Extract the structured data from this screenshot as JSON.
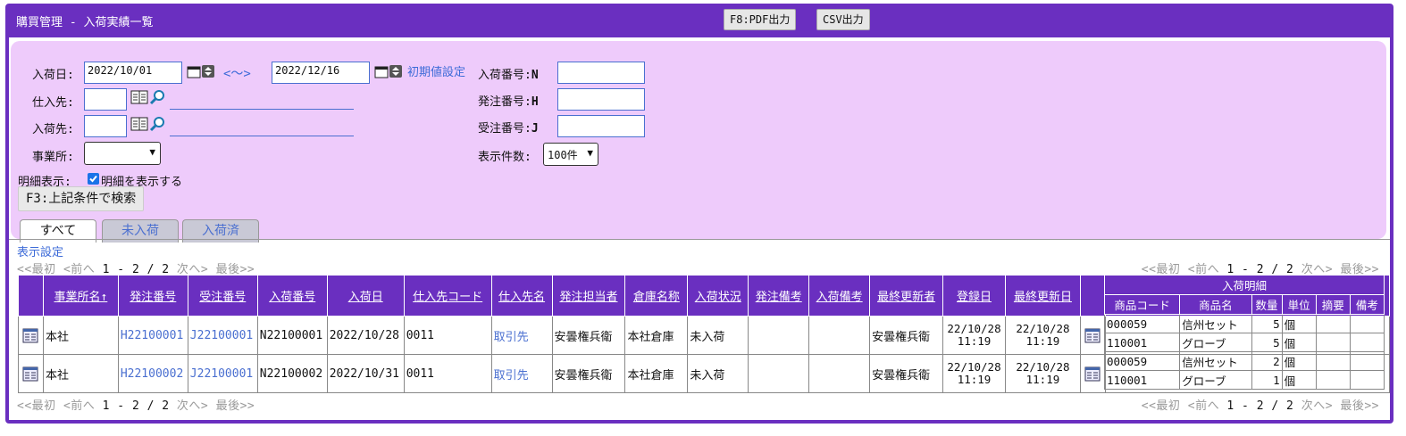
{
  "window": {
    "title": "購買管理 - 入荷実績一覧"
  },
  "toolbar": {
    "pdf_label": "F8:PDF出力",
    "csv_label": "CSV出力"
  },
  "search": {
    "arrival_date_label": "入荷日:",
    "date_from": "2022/10/01",
    "range_sep": "<～>",
    "date_to": "2022/12/16",
    "reset_link": "初期値設定",
    "supplier_label": "仕入先:",
    "receiver_label": "入荷先:",
    "office_label": "事業所:",
    "detail_label": "明細表示:",
    "detail_checkbox_label": "明細を表示する",
    "arrival_no_label": "入荷番号:",
    "arrival_no_key": "N",
    "order_no_label": "発注番号:",
    "order_no_key": "H",
    "receive_no_label": "受注番号:",
    "receive_no_key": "J",
    "count_label": "表示件数:",
    "count_value": "100件",
    "search_button": "F3:上記条件で検索"
  },
  "tabs": [
    {
      "label": "すべて",
      "active": true
    },
    {
      "label": "未入荷",
      "active": false
    },
    {
      "label": "入荷済",
      "active": false
    }
  ],
  "display_settings": "表示設定",
  "pager": {
    "first": "<<最初",
    "prev": "<前へ",
    "range": "1 - 2 / 2",
    "next": "次へ>",
    "last": "最後>>"
  },
  "table": {
    "headers": [
      "事業所名↑",
      "発注番号",
      "受注番号",
      "入荷番号",
      "入荷日",
      "仕入先コード",
      "仕入先名",
      "発注担当者",
      "倉庫名称",
      "入荷状況",
      "発注備考",
      "入荷備考",
      "最終更新者",
      "登録日",
      "最終更新日"
    ],
    "detail_group": "入荷明細",
    "detail_headers": [
      "商品コード",
      "商品名",
      "数量",
      "単位",
      "摘要",
      "備考"
    ],
    "rows": [
      {
        "office": "本社",
        "order_no": "H22100001",
        "receive_no": "J22100001",
        "arrival_no": "N22100001",
        "arrival_date": "2022/10/28",
        "supplier_code": "0011",
        "supplier_name": "取引先",
        "order_staff": "安曇権兵衛",
        "warehouse": "本社倉庫",
        "status": "未入荷",
        "order_note": "",
        "arrival_note": "",
        "updater": "安曇権兵衛",
        "reg_date": "22/10/28",
        "reg_time": "11:19",
        "upd_date": "22/10/28",
        "upd_time": "11:19",
        "details": [
          {
            "code": "000059",
            "name": "信州セット",
            "qty": "5",
            "unit": "個",
            "summary": "",
            "note": ""
          },
          {
            "code": "110001",
            "name": "グローブ",
            "qty": "5",
            "unit": "個",
            "summary": "",
            "note": ""
          }
        ]
      },
      {
        "office": "本社",
        "order_no": "H22100002",
        "receive_no": "J22100001",
        "arrival_no": "N22100002",
        "arrival_date": "2022/10/31",
        "supplier_code": "0011",
        "supplier_name": "取引先",
        "order_staff": "安曇権兵衛",
        "warehouse": "本社倉庫",
        "status": "未入荷",
        "order_note": "",
        "arrival_note": "",
        "updater": "安曇権兵衛",
        "reg_date": "22/10/28",
        "reg_time": "11:19",
        "upd_date": "22/10/28",
        "upd_time": "11:19",
        "details": [
          {
            "code": "000059",
            "name": "信州セット",
            "qty": "2",
            "unit": "個",
            "summary": "",
            "note": ""
          },
          {
            "code": "110001",
            "name": "グローブ",
            "qty": "1",
            "unit": "個",
            "summary": "",
            "note": ""
          }
        ]
      }
    ]
  },
  "colors": {
    "header": "#6a2fc0",
    "panel": "#eecbfb",
    "link": "#4a6fd0"
  }
}
